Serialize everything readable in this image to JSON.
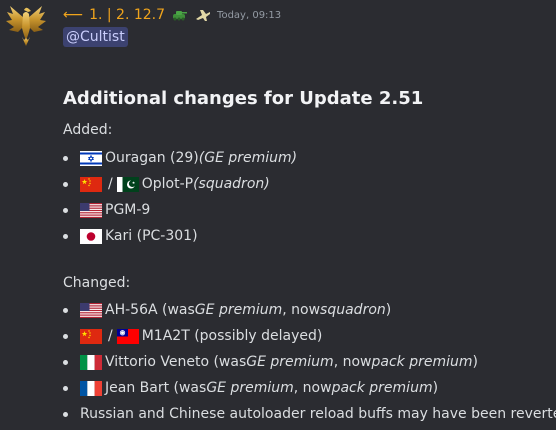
{
  "message": {
    "author": {
      "name": "1. | 2. 12.7",
      "name_color": "#f0a41c",
      "arrow_icon": "left-arrow-icon",
      "role_icons": [
        "tank-icon",
        "jet-icon"
      ]
    },
    "timestamp": "Today, 09:13",
    "mention": "@Cultist",
    "heading": "Additional changes for Update 2.51",
    "added": {
      "label": "Added:",
      "items": [
        {
          "flags": [
            "israel-flag-icon"
          ],
          "text": "Ouragan (29) ",
          "em": "(GE premium)"
        },
        {
          "flags": [
            "china-flag-icon",
            "pakistan-flag-icon"
          ],
          "sep": "/",
          "text": "Oplot-P ",
          "em": "(squadron)"
        },
        {
          "flags": [
            "usa-flag-icon"
          ],
          "text": "PGM-9"
        },
        {
          "flags": [
            "japan-flag-icon"
          ],
          "text": "Kari (PC-301)"
        }
      ]
    },
    "changed": {
      "label": "Changed:",
      "items": [
        {
          "flags": [
            "usa-flag-icon"
          ],
          "p1": "AH-56A (was ",
          "e1": "GE premium",
          "p2": ", now ",
          "e2": "squadron",
          "p3": ")"
        },
        {
          "flags": [
            "china-flag-icon",
            "taiwan-flag-icon"
          ],
          "sep": "/",
          "p1": "M1A2T (possibly delayed)"
        },
        {
          "flags": [
            "italy-flag-icon"
          ],
          "p1": "Vittorio Veneto (was ",
          "e1": "GE premium",
          "p2": ", now ",
          "e2": "pack premium",
          "p3": ")"
        },
        {
          "flags": [
            "france-flag-icon"
          ],
          "p1": "Jean Bart (was ",
          "e1": "GE premium",
          "p2": ", now ",
          "e2": "pack premium",
          "p3": ")"
        },
        {
          "flags": [],
          "p1": "Russian and Chinese autoloader reload buffs may have been reverted"
        }
      ]
    }
  }
}
